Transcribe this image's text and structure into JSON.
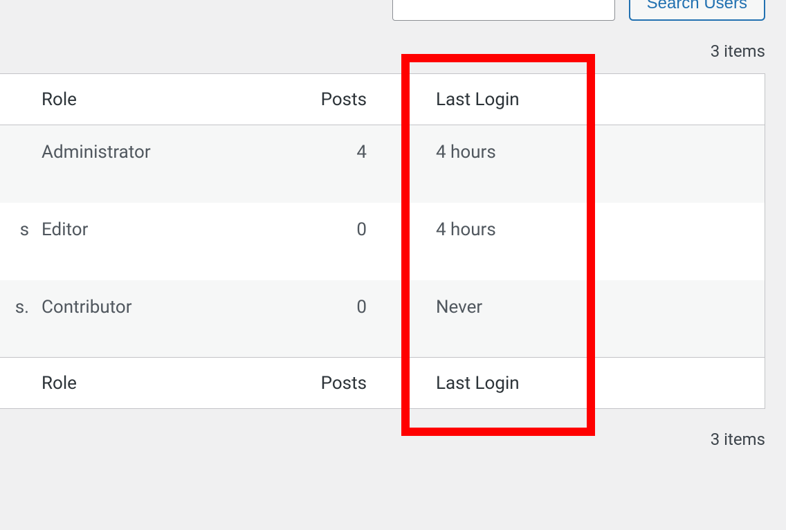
{
  "search": {
    "placeholder": "",
    "button_label": "Search Users"
  },
  "pagination": {
    "top_count": "3 items",
    "bottom_count": "3 items"
  },
  "table": {
    "headers": {
      "role": "Role",
      "posts": "Posts",
      "last_login": "Last Login"
    },
    "footers": {
      "role": "Role",
      "posts": "Posts",
      "last_login": "Last Login"
    },
    "rows": [
      {
        "leading": "",
        "role": "Administrator",
        "posts": "4",
        "posts_link": true,
        "last_login": "4 hours"
      },
      {
        "leading": "s",
        "role": "Editor",
        "posts": "0",
        "posts_link": false,
        "last_login": "4 hours"
      },
      {
        "leading": "s.",
        "role": "Contributor",
        "posts": "0",
        "posts_link": false,
        "last_login": "Never"
      }
    ]
  }
}
